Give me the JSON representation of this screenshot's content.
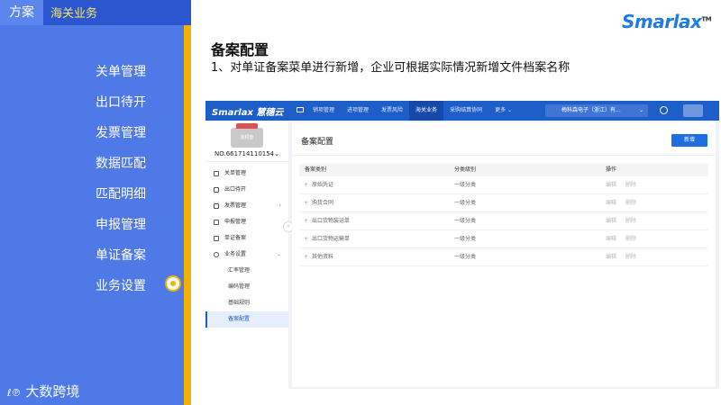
{
  "slide": {
    "tag_left": "方案",
    "tag_section": "海关业务",
    "menu": [
      "关单管理",
      "出口待开",
      "发票管理",
      "数据匹配",
      "匹配明细",
      "申报管理",
      "单证备案",
      "业务设置"
    ],
    "logo_text": "大数跨境",
    "brand": "Smarlax",
    "brand_tm": "TM",
    "title": "备案配置",
    "description": "1、对单证备案菜单进行新增，企业可根据实际情况新增文件档案名称",
    "colors": {
      "panel": "#4f79e6",
      "topbar": "#2c56cf",
      "accent": "#f2b200",
      "section_text": "#f5e663"
    }
  },
  "app": {
    "brand": "Smarlax 慧穗云",
    "nav": [
      "销项管理",
      "进项管理",
      "发票风险",
      "海关业务",
      "采购结算协同",
      "更多 ⌄"
    ],
    "active_nav": "海关业务",
    "company": "梅科森电子（浙江）有...",
    "company_chevron": "⌄",
    "stamp_text": "金税盘",
    "account": "NO.661714110154⌄",
    "side_menu": [
      {
        "label": "关单管理",
        "icon": "building-icon"
      },
      {
        "label": "出口待开",
        "icon": "box-icon"
      },
      {
        "label": "发票管理",
        "icon": "invoice-icon",
        "arrow": "›"
      },
      {
        "label": "申报管理",
        "icon": "layers-icon"
      },
      {
        "label": "单证备案",
        "icon": "document-icon"
      },
      {
        "label": "业务设置",
        "icon": "gear-icon",
        "arrow": "⌄"
      }
    ],
    "side_sub": [
      "汇率管理",
      "编码管理",
      "基础规则",
      "备案配置"
    ],
    "active_sub": "备案配置",
    "collapse": "‹",
    "page_title": "备案配置",
    "add_button": "新增",
    "table": {
      "headers": [
        "备案类别",
        "分类级别",
        "操作"
      ],
      "rows": [
        {
          "name": "原始凭证",
          "level": "一级分类"
        },
        {
          "name": "购货合同",
          "level": "一级分类"
        },
        {
          "name": "出口货物装运单",
          "level": "一级分类"
        },
        {
          "name": "出口货物运输单",
          "level": "一级分类"
        },
        {
          "name": "其他资料",
          "level": "一级分类"
        }
      ],
      "actions": [
        "编辑",
        "删除"
      ],
      "expand": "+"
    }
  }
}
